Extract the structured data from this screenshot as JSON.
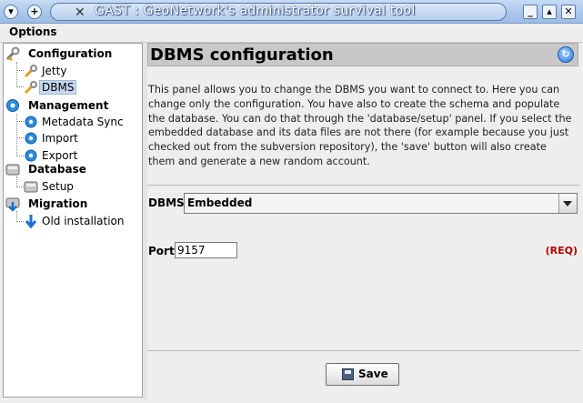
{
  "window": {
    "title": "GAST : GeoNetwork's administrator survival tool",
    "buttons": {
      "menu": "▾",
      "pin": "+",
      "minimize": "_",
      "maximize": "▴",
      "close": "✕"
    }
  },
  "menubar": {
    "options_label": "Options"
  },
  "tree": {
    "categories": [
      {
        "label": "Configuration",
        "icon": "wrench-icon",
        "children": [
          "Jetty",
          "DBMS"
        ]
      },
      {
        "label": "Management",
        "icon": "gear-icon",
        "children": [
          "Metadata Sync",
          "Import",
          "Export"
        ]
      },
      {
        "label": "Database",
        "icon": "database-icon",
        "children": [
          "Setup"
        ]
      },
      {
        "label": "Migration",
        "icon": "migration-icon",
        "children": [
          "Old installation"
        ]
      }
    ],
    "selected": "DBMS"
  },
  "panel": {
    "title": "DBMS configuration",
    "description": "This panel allows you to change the DBMS you want to connect to. Here you can change only the configuration. You have also to create the schema and populate the database. You can do that through the 'database/setup' panel. If you select the embedded database and its data files are not there (for example because you just checked out from the subversion repository), the 'save' button will also create them and generate a new random account.",
    "dbms_label": "DBMS",
    "dbms_value": "Embedded",
    "port_label": "Port",
    "port_value": "9157",
    "required_marker": "(REQ)",
    "save_label": "Save"
  },
  "colors": {
    "accent": "#a9c6ea",
    "required": "#b00000",
    "header": "#c8c8c8"
  }
}
